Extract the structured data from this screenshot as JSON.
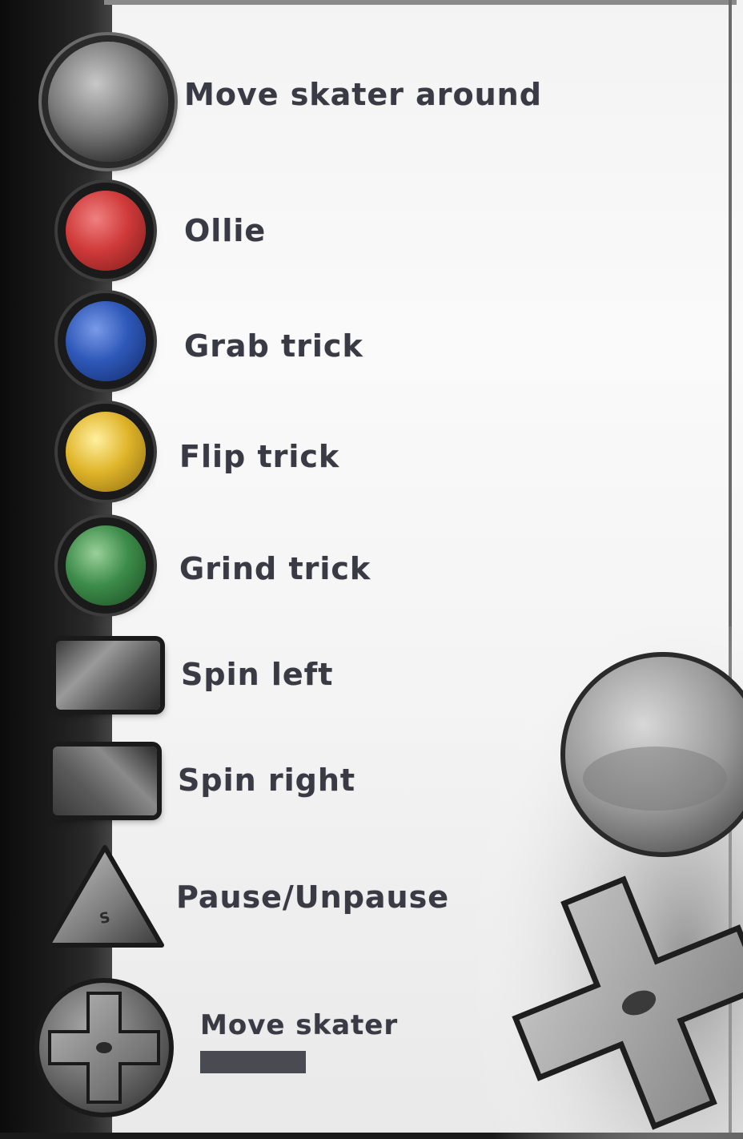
{
  "controls": [
    {
      "icon": "analog-stick-icon",
      "label": "Move skater around"
    },
    {
      "icon": "red-button-icon",
      "label": "Ollie",
      "color": "#d03a3a"
    },
    {
      "icon": "blue-button-icon",
      "label": "Grab trick",
      "color": "#2e58b8"
    },
    {
      "icon": "yellow-button-icon",
      "label": "Flip trick",
      "color": "#e0b52a"
    },
    {
      "icon": "green-button-icon",
      "label": "Grind trick",
      "color": "#3d8c4a"
    },
    {
      "icon": "left-shoulder-button-icon",
      "label": "Spin left"
    },
    {
      "icon": "right-shoulder-button-icon",
      "label": "Spin right"
    },
    {
      "icon": "start-triangle-button-icon",
      "label": "Pause/Unpause"
    },
    {
      "icon": "dpad-icon",
      "label": "Move skater"
    }
  ]
}
